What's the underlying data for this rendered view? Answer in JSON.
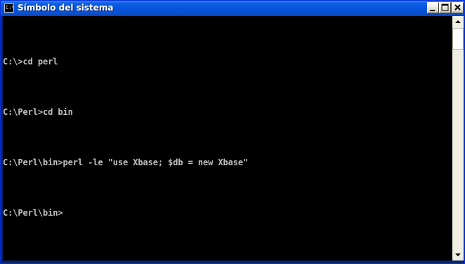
{
  "window": {
    "title": "Símbolo del sistema",
    "icon": "cmd-console-icon",
    "icon_glyph": "C:\\"
  },
  "titlebar_buttons": [
    {
      "name": "minimize",
      "icon": "minimize-icon"
    },
    {
      "name": "maximize",
      "icon": "maximize-icon"
    },
    {
      "name": "close",
      "icon": "close-icon"
    }
  ],
  "console": {
    "lines": [
      "C:\\>cd perl",
      "C:\\Perl>cd bin",
      "C:\\Perl\\bin>perl -le \"use Xbase; $db = new Xbase\"",
      "C:\\Perl\\bin>"
    ]
  },
  "colors": {
    "console_bg": "#000000",
    "console_fg": "#c0c0c0",
    "titlebar": "#0553dd"
  }
}
